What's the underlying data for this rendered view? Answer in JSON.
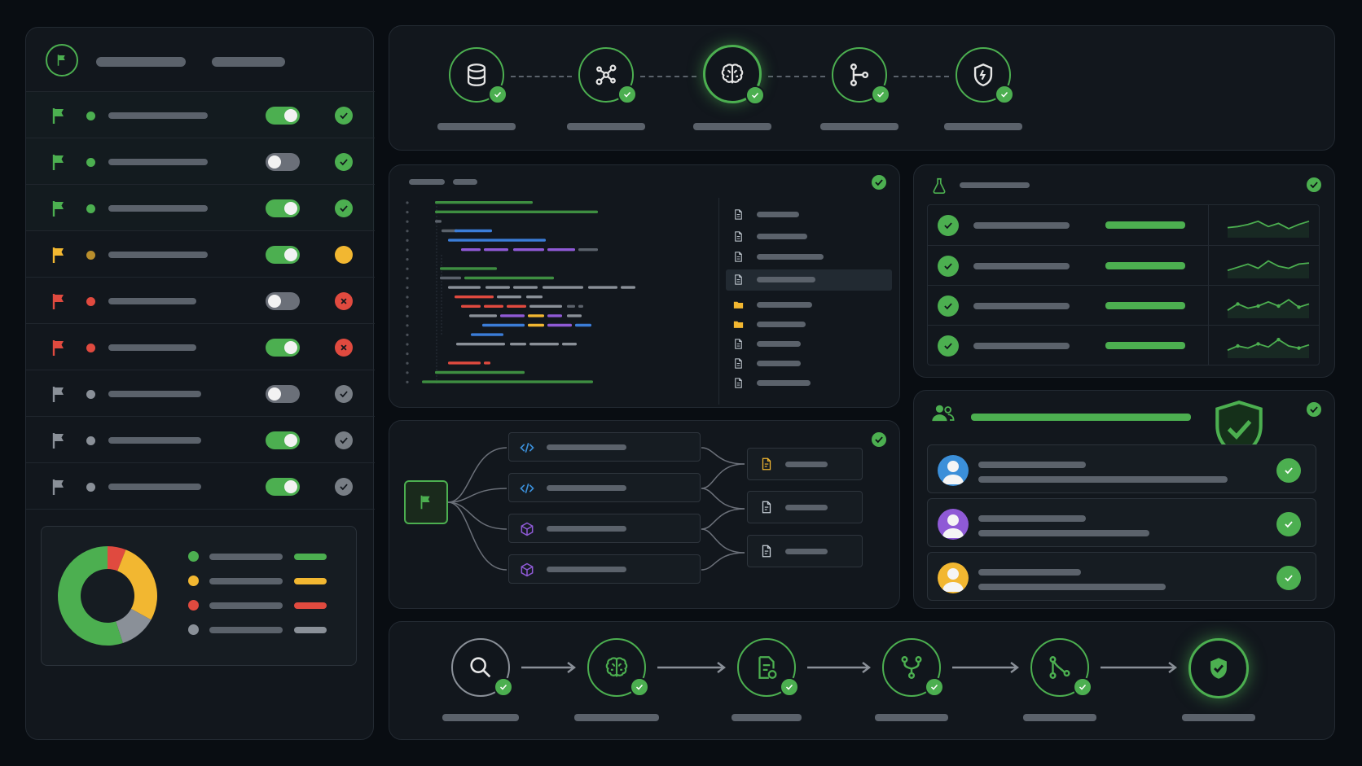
{
  "theme": {
    "accent": "#4caf50",
    "warning": "#f2b731",
    "danger": "#e04a3f",
    "neutral": "#8a9098",
    "background": "#090d12",
    "panel": "#12171d"
  },
  "sidebar": {
    "header_icon": "flag-icon",
    "flags": [
      {
        "status": "green",
        "enabled": true
      },
      {
        "status": "green",
        "enabled": false
      },
      {
        "status": "green",
        "enabled": true
      },
      {
        "status": "yellow",
        "enabled": true
      },
      {
        "status": "red",
        "enabled": false
      },
      {
        "status": "red",
        "enabled": true
      },
      {
        "status": "gray",
        "enabled": false
      },
      {
        "status": "gray",
        "enabled": true
      },
      {
        "status": "gray",
        "enabled": true
      }
    ],
    "donut": {
      "segments": [
        {
          "color": "#4caf50",
          "value": 0.55
        },
        {
          "color": "#f2b731",
          "value": 0.27
        },
        {
          "color": "#8a9098",
          "value": 0.12
        },
        {
          "color": "#e04a3f",
          "value": 0.06
        }
      ]
    }
  },
  "pipeline_top": {
    "steps": [
      {
        "icon": "database-icon",
        "done": true
      },
      {
        "icon": "network-nodes-icon",
        "done": true
      },
      {
        "icon": "brain-icon",
        "done": true,
        "active": true
      },
      {
        "icon": "git-branch-icon",
        "done": true
      },
      {
        "icon": "shield-icon",
        "done": true
      }
    ]
  },
  "code_panel": {
    "status": "success",
    "file_icons": [
      "file-icon",
      "file-icon",
      "file-icon",
      "file-icon",
      "folder-icon",
      "folder-icon",
      "file-icon",
      "file-icon",
      "file-icon"
    ]
  },
  "tests_panel": {
    "icon": "flask-icon",
    "rows": [
      {
        "passed": true,
        "progress": 1.0,
        "sparkline": [
          0.4,
          0.45,
          0.55,
          0.7,
          0.45,
          0.6,
          0.35,
          0.55,
          0.7
        ]
      },
      {
        "passed": true,
        "progress": 1.0,
        "sparkline": [
          0.3,
          0.45,
          0.6,
          0.4,
          0.75,
          0.5,
          0.4,
          0.6,
          0.65
        ]
      },
      {
        "passed": true,
        "progress": 1.0,
        "sparkline": [
          0.3,
          0.6,
          0.4,
          0.5,
          0.7,
          0.5,
          0.8,
          0.45,
          0.6
        ]
      },
      {
        "passed": true,
        "progress": 1.0,
        "sparkline": [
          0.3,
          0.5,
          0.4,
          0.6,
          0.45,
          0.8,
          0.5,
          0.4,
          0.55
        ]
      }
    ]
  },
  "flow_panel": {
    "source_icon": "flag-icon",
    "branches": [
      "code-icon",
      "code-icon",
      "package-icon",
      "package-icon"
    ],
    "outputs": [
      "document-warning-icon",
      "document-icon",
      "document-icon"
    ]
  },
  "users_panel": {
    "icon": "users-icon",
    "badge_icon": "shield-check-icon",
    "users": [
      {
        "avatar_color": "#3b8fd9",
        "approved": true
      },
      {
        "avatar_color": "#8f5ad6",
        "approved": true
      },
      {
        "avatar_color": "#f2b731",
        "approved": true
      }
    ]
  },
  "pipeline_bottom": {
    "steps": [
      {
        "icon": "search-icon",
        "done": true
      },
      {
        "icon": "brain-icon",
        "done": true
      },
      {
        "icon": "document-edit-icon",
        "done": true
      },
      {
        "icon": "git-fork-icon",
        "done": true
      },
      {
        "icon": "git-merge-icon",
        "done": true
      },
      {
        "icon": "shield-check-icon",
        "done": true,
        "final": true
      }
    ]
  }
}
